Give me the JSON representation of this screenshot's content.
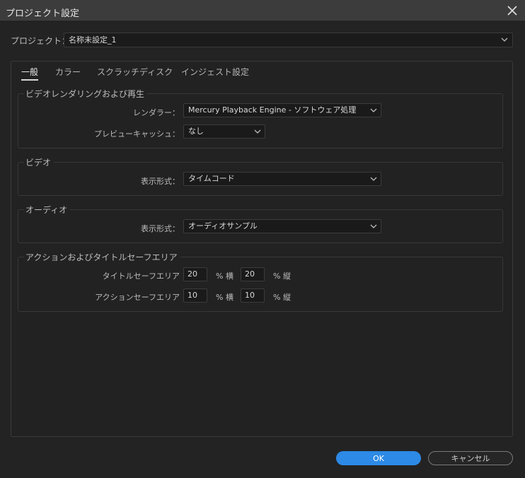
{
  "window": {
    "title": "プロジェクト設定",
    "close_icon": "close-icon"
  },
  "project": {
    "label": "プロジェクト：",
    "value": "名称未設定_1"
  },
  "tabs": [
    {
      "label": "一般",
      "active": true
    },
    {
      "label": "カラー",
      "active": false
    },
    {
      "label": "スクラッチディスク",
      "active": false
    },
    {
      "label": "インジェスト設定",
      "active": false
    }
  ],
  "video_rendering": {
    "title": "ビデオレンダリングおよび再生",
    "renderer_label": "レンダラー：",
    "renderer_value": "Mercury Playback Engine - ソフトウェア処理",
    "preview_cache_label": "プレビューキャッシュ：",
    "preview_cache_value": "なし"
  },
  "video": {
    "title": "ビデオ",
    "display_format_label": "表示形式：",
    "display_format_value": "タイムコード"
  },
  "audio": {
    "title": "オーディオ",
    "display_format_label": "表示形式：",
    "display_format_value": "オーディオサンプル"
  },
  "safe_areas": {
    "title": "アクションおよびタイトルセーフエリア",
    "title_safe_label": "タイトルセーフエリア",
    "title_safe_h": "20",
    "title_safe_v": "20",
    "action_safe_label": "アクションセーフエリア",
    "action_safe_h": "10",
    "action_safe_v": "10",
    "unit_h": "% 横",
    "unit_v": "% 縦"
  },
  "buttons": {
    "ok": "OK",
    "cancel": "キャンセル"
  },
  "colors": {
    "accent": "#2d8ae6",
    "background": "#232323",
    "titlebar": "#3c3c3c"
  }
}
